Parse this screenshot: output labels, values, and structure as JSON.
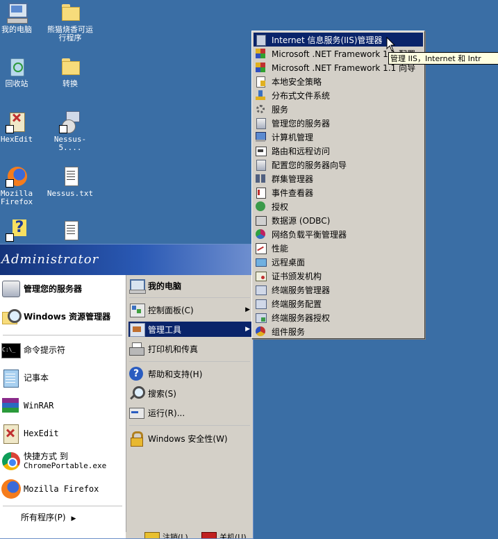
{
  "desktop": {
    "icons": [
      {
        "label": "我的电脑",
        "icon": "my-computer-icon"
      },
      {
        "label": "熊猫烧香可运行程序",
        "icon": "folder-icon"
      },
      {
        "label": "回收站",
        "icon": "recycle-bin-icon"
      },
      {
        "label": "转换",
        "icon": "folder-icon"
      },
      {
        "label": "HexEdit",
        "icon": "hexedit-icon"
      },
      {
        "label": "Nessus-5....",
        "icon": "nessus-installer-icon"
      },
      {
        "label": "Mozilla Firefox",
        "icon": "firefox-icon"
      },
      {
        "label": "Nessus.txt",
        "icon": "text-file-icon"
      },
      {
        "label": "",
        "icon": "help-shortcut-icon"
      },
      {
        "label": "",
        "icon": "text-file-icon"
      }
    ]
  },
  "start_menu": {
    "user": "Administrator",
    "left_items": [
      {
        "label": "管理您的服务器",
        "icon": "manage-server-icon"
      },
      {
        "label": "Windows 资源管理器",
        "icon": "explorer-icon"
      },
      {
        "label": "命令提示符",
        "icon": "cmd-icon"
      },
      {
        "label": "记事本",
        "icon": "notepad-icon"
      },
      {
        "label": "WinRAR",
        "icon": "winrar-icon"
      },
      {
        "label": "HexEdit",
        "icon": "hexedit-icon"
      },
      {
        "label": "快捷方式 到",
        "label2": "ChromePortable.exe",
        "icon": "chrome-icon"
      },
      {
        "label": "Mozilla Firefox",
        "icon": "firefox-icon"
      }
    ],
    "all_programs": "所有程序(P)",
    "right_items": [
      {
        "label": "我的电脑",
        "icon": "my-computer-icon"
      },
      {
        "label": "控制面板(C)",
        "icon": "control-panel-icon"
      },
      {
        "label": "管理工具",
        "icon": "admin-tools-icon"
      },
      {
        "label": "打印机和传真",
        "icon": "printer-icon"
      },
      {
        "label": "帮助和支持(H)",
        "icon": "help-icon"
      },
      {
        "label": "搜索(S)",
        "icon": "search-icon"
      },
      {
        "label": "运行(R)...",
        "icon": "run-icon"
      },
      {
        "label": "Windows 安全性(W)",
        "icon": "security-icon"
      }
    ],
    "bottom": {
      "logoff": "注销(L)",
      "shutdown": "关机(U)"
    }
  },
  "admin_tools_menu": {
    "items": [
      "Internet 信息服务(IIS)管理器",
      "Microsoft .NET Framework 1.1 配置",
      "Microsoft .NET Framework 1.1 向导",
      "本地安全策略",
      "分布式文件系统",
      "服务",
      "管理您的服务器",
      "计算机管理",
      "路由和远程访问",
      "配置您的服务器向导",
      "群集管理器",
      "事件查看器",
      "授权",
      "数据源 (ODBC)",
      "网络负载平衡管理器",
      "性能",
      "远程桌面",
      "证书颁发机构",
      "终端服务管理器",
      "终端服务配置",
      "终端服务器授权",
      "组件服务"
    ],
    "highlighted_index": 0
  },
  "tooltip": "管理 IIS，Internet 和 Intr",
  "colors": {
    "desktop": "#3a6ea5",
    "highlight": "#0a246a",
    "menu_bg": "#d4d0c8"
  }
}
